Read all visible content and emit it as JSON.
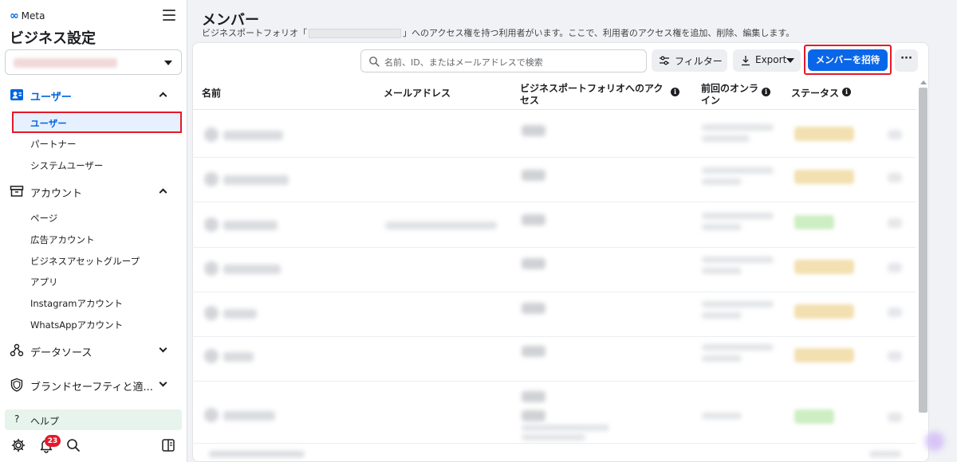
{
  "sidebar": {
    "logo": "Meta",
    "title": "ビジネス設定",
    "sections": {
      "users": {
        "label": "ユーザー"
      },
      "accounts": {
        "label": "アカウント"
      },
      "datasources": {
        "label": "データソース"
      },
      "brandsafety": {
        "label": "ブランドセーフティと適..."
      }
    },
    "user_items": [
      "ユーザー",
      "パートナー",
      "システムユーザー"
    ],
    "account_items": [
      "ページ",
      "広告アカウント",
      "ビジネスアセットグループ",
      "アプリ",
      "Instagramアカウント",
      "WhatsAppアカウント"
    ],
    "help": "ヘルプ",
    "notification_count": "23"
  },
  "main": {
    "title": "メンバー",
    "description_before": "ビジネスポートフォリオ「",
    "description_after": "」へのアクセス権を持つ利用者がいます。ここで、利用者のアクセス権を追加、削除、編集します。",
    "search_placeholder": "名前、ID、またはメールアドレスで検索",
    "filter_label": "フィルター",
    "export_label": "Export",
    "invite_label": "メンバーを招待",
    "more_label": "···",
    "columns": {
      "name": "名前",
      "email": "メールアドレス",
      "access": "ビジネスポートフォリオへのアクセス",
      "last_online": "前回のオンライン",
      "status": "ステータス"
    }
  },
  "colors": {
    "accent": "#0064e0",
    "invite_button": "#0a66e8",
    "highlight_border": "#e4192b",
    "help_bg": "#e6f4ec"
  }
}
